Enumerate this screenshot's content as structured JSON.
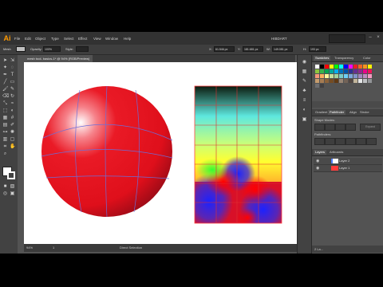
{
  "app": {
    "logo": "Ai",
    "workspace": "HIBDART"
  },
  "menu": [
    "File",
    "Edit",
    "Object",
    "Type",
    "Select",
    "Effect",
    "View",
    "Window",
    "Help"
  ],
  "control_bar": {
    "selection_label": "Mesh",
    "opacity_label": "Opacity:",
    "opacity_value": "100%",
    "style_label": "Style:",
    "x_label": "X:",
    "x_value": "61.546 px",
    "y_label": "Y:",
    "y_value": "181.681 px",
    "w_label": "W:",
    "w_value": "149.081 px",
    "h_label": "H:",
    "h_value": "193 px"
  },
  "document_tab": "mesh tool- basics-1* @ 94% (RGB/Preview)",
  "status": {
    "zoom": "94%",
    "page": "1",
    "tool": "Direct Selection"
  },
  "panels": {
    "swatches_tabs": [
      "Swatches",
      "Transparency",
      "Color"
    ],
    "pathfinder_tabs": [
      "Gradient",
      "Pathfinder",
      "Align",
      "Stroke"
    ],
    "shape_modes_label": "Shape Modes:",
    "expand_label": "Expand",
    "pathfinders_label": "Pathfinders:",
    "layers_tabs": [
      "Layers",
      "Artboards"
    ],
    "layers": [
      {
        "name": "Layer 2",
        "color": "#4f7bff"
      },
      {
        "name": "Layer 1",
        "color": "#ff3b3b"
      }
    ],
    "layers_count": "2 La..."
  },
  "colors": {
    "accent_logo": "#ff9a00",
    "sphere_red": "#e8131f",
    "mesh_line": "#6d6dd8"
  },
  "swatches": [
    "#ffffff",
    "#000000",
    "#ff0000",
    "#ffff00",
    "#00ff00",
    "#00ffff",
    "#0000ff",
    "#ff00ff",
    "#ed1c24",
    "#f26522",
    "#f7941d",
    "#fff200",
    "#8dc63f",
    "#39b54a",
    "#00a651",
    "#00a99d",
    "#00aeef",
    "#0072bc",
    "#0054a6",
    "#2e3192",
    "#662d91",
    "#92278f",
    "#ec008c",
    "#ed145b",
    "#f69679",
    "#fbaf5d",
    "#fff799",
    "#c4df9b",
    "#a3d39c",
    "#7accc8",
    "#6dcff6",
    "#7da7d9",
    "#8393ca",
    "#a187be",
    "#bd8cbf",
    "#f49ac1",
    "#c69c6d",
    "#a67c52",
    "#8c6239",
    "#754c24",
    "#603913",
    "#998675",
    "#736357",
    "#534741",
    "#c2b59b",
    "#e6e7e8",
    "#bcbec0",
    "#939598",
    "#6d6e71",
    "#414042"
  ]
}
